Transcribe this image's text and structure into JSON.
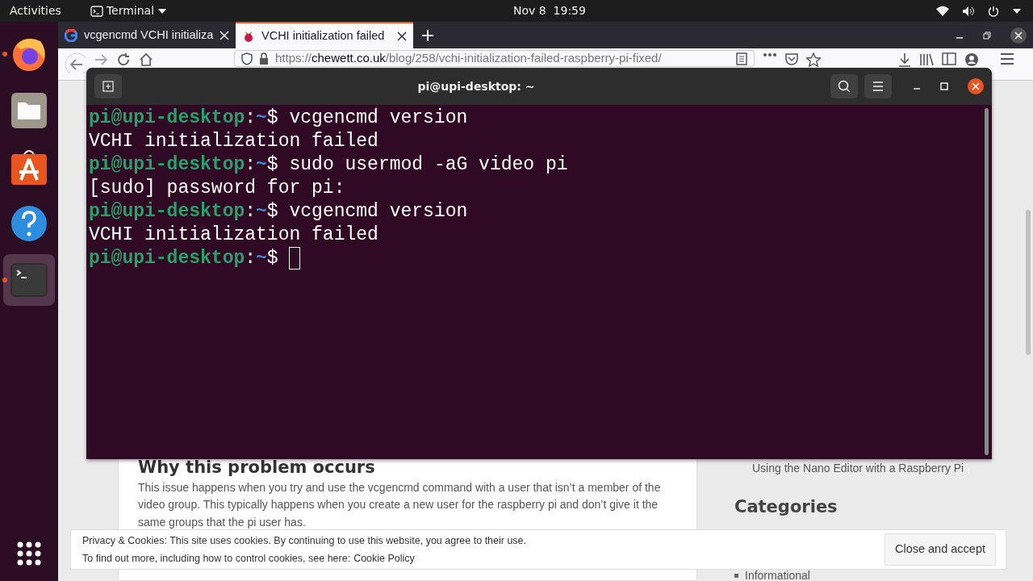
{
  "top_bar": {
    "activities": "Activities",
    "app_menu": "Terminal",
    "clock": "Nov 8  19:59"
  },
  "dock": {
    "items": [
      {
        "kind": "firefox",
        "running": true,
        "selected": false
      },
      {
        "kind": "files",
        "running": false,
        "selected": false
      },
      {
        "kind": "store",
        "running": false,
        "selected": false
      },
      {
        "kind": "help",
        "running": false,
        "selected": false
      },
      {
        "kind": "terminal",
        "running": true,
        "selected": true
      }
    ]
  },
  "browser": {
    "tabs": [
      {
        "title": "vcgencmd VCHI initializa",
        "selected": false,
        "kind": "google"
      },
      {
        "title": "VCHI initialization failed",
        "selected": true,
        "kind": "raspberry"
      }
    ],
    "url_host": "chewett.co.uk",
    "url_scheme": "https://",
    "url_path": "/blog/258/vchi-initialization-failed-raspberry-pi-fixed/",
    "page": {
      "heading": "Why this problem occurs",
      "paragraph": "This issue happens when you try and use the vcgencmd command with a user that isn’t a member of the video group. This typically happens when you create a new user for the raspberry pi and don’t give it the same groups that the pi user has.",
      "sidebar_link": "Using the Nano Editor with a Raspberry Pi",
      "categories_heading": "Categories",
      "categories": [
        "Informational"
      ]
    },
    "cookie_bar": {
      "line1": "Privacy & Cookies: This site uses cookies. By continuing to use this website, you agree to their use.",
      "line2": "To find out more, including how to control cookies, see here:",
      "link": "Cookie Policy",
      "button": "Close and accept"
    }
  },
  "terminal": {
    "title": "pi@upi-desktop: ~",
    "lines": [
      {
        "kind": "prompt",
        "user": "pi@upi-desktop",
        "separator": ":",
        "path": "~",
        "sign": "$",
        "text": "vcgencmd version"
      },
      {
        "kind": "output",
        "text": "VCHI initialization failed"
      },
      {
        "kind": "prompt",
        "user": "pi@upi-desktop",
        "separator": ":",
        "path": "~",
        "sign": "$",
        "text": "sudo usermod -aG video pi"
      },
      {
        "kind": "output",
        "text": "[sudo] password for pi:"
      },
      {
        "kind": "prompt",
        "user": "pi@upi-desktop",
        "separator": ":",
        "path": "~",
        "sign": "$",
        "text": "vcgencmd version"
      },
      {
        "kind": "output",
        "text": "VCHI initialization failed"
      },
      {
        "kind": "prompt",
        "user": "pi@upi-desktop",
        "separator": ":",
        "path": "~",
        "sign": "$",
        "cursor": true
      }
    ]
  }
}
